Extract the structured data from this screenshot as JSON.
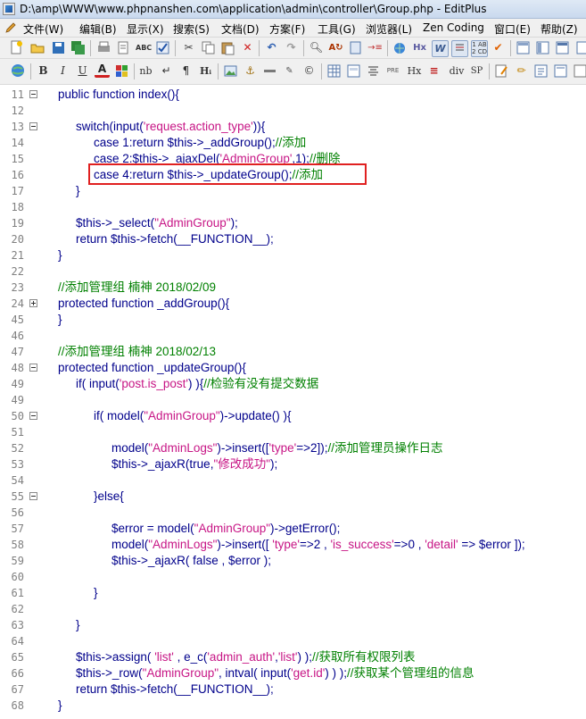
{
  "window": {
    "title": "D:\\amp\\WWW\\www.phpnanshen.com\\application\\admin\\controller\\Group.php - EditPlus"
  },
  "menu": [
    "文件(W)",
    "编辑(B)",
    "显示(X)",
    "搜索(S)",
    "文档(D)",
    "方案(F)",
    "工具(G)",
    "浏览器(L)",
    "Zen Coding",
    "窗口(E)",
    "帮助(Z)"
  ],
  "toolbar1": {
    "icons": [
      "new-file",
      "open-folder",
      "save",
      "save-all",
      "print",
      "print-preview",
      "spell-check",
      "check",
      "cut",
      "copy",
      "paste",
      "delete",
      "undo",
      "redo",
      "find",
      "replace",
      "clipboard",
      "indent",
      "web-browser",
      "hex",
      "word-wrap",
      "line-numbers",
      "column-number",
      "check-mark",
      "function-list",
      "directory",
      "window-list",
      "tag-list"
    ]
  },
  "toolbar2": {
    "labels": {
      "nbsp": "nb",
      "pre": "PRE",
      "div": "div",
      "span": "SP",
      "hx": "Hx",
      "html": "Hᵢ"
    }
  },
  "code_lines": [
    {
      "n": "11",
      "fold": "minus",
      "segs": [
        {
          "t": "public function index(){",
          "c": ""
        }
      ]
    },
    {
      "n": "12",
      "segs": []
    },
    {
      "n": "13",
      "fold": "minus",
      "segs": [
        {
          "t": "    switch(input(",
          "c": ""
        },
        {
          "t": "'request.action_type'",
          "c": "str"
        },
        {
          "t": ")){",
          "c": ""
        }
      ]
    },
    {
      "n": "14",
      "segs": [
        {
          "t": "        case 1:return ",
          "c": ""
        },
        {
          "t": "$this",
          "c": "dol"
        },
        {
          "t": "->_addGroup();",
          "c": ""
        },
        {
          "t": "//添加",
          "c": "com"
        }
      ]
    },
    {
      "n": "15",
      "segs": [
        {
          "t": "        case 2:",
          "c": ""
        },
        {
          "t": "$this",
          "c": "dol"
        },
        {
          "t": "->_ajaxDel(",
          "c": ""
        },
        {
          "t": "'AdminGroup'",
          "c": "str"
        },
        {
          "t": ",1);",
          "c": ""
        },
        {
          "t": "//删除",
          "c": "com"
        }
      ]
    },
    {
      "n": "16",
      "segs": [
        {
          "t": "        case 4:return ",
          "c": ""
        },
        {
          "t": "$this",
          "c": "dol"
        },
        {
          "t": "->_updateGroup();",
          "c": ""
        },
        {
          "t": "//添加",
          "c": "com"
        }
      ]
    },
    {
      "n": "17",
      "segs": [
        {
          "t": "    }",
          "c": ""
        }
      ]
    },
    {
      "n": "18",
      "segs": []
    },
    {
      "n": "19",
      "segs": [
        {
          "t": "    ",
          "c": ""
        },
        {
          "t": "$this",
          "c": "dol"
        },
        {
          "t": "->_select(",
          "c": ""
        },
        {
          "t": "\"AdminGroup\"",
          "c": "str"
        },
        {
          "t": ");",
          "c": ""
        }
      ]
    },
    {
      "n": "20",
      "segs": [
        {
          "t": "    return ",
          "c": ""
        },
        {
          "t": "$this",
          "c": "dol"
        },
        {
          "t": "->fetch(__FUNCTION__);",
          "c": ""
        }
      ]
    },
    {
      "n": "21",
      "segs": [
        {
          "t": "}",
          "c": ""
        }
      ]
    },
    {
      "n": "22",
      "segs": []
    },
    {
      "n": "23",
      "segs": [
        {
          "t": "//添加管理组 楠神 2018/02/09",
          "c": "com"
        }
      ]
    },
    {
      "n": "24",
      "fold": "plus",
      "segs": [
        {
          "t": "protected function _addGroup(){",
          "c": ""
        }
      ]
    },
    {
      "n": "45",
      "segs": [
        {
          "t": "}",
          "c": ""
        }
      ]
    },
    {
      "n": "46",
      "segs": []
    },
    {
      "n": "47",
      "segs": [
        {
          "t": "//添加管理组 楠神 2018/02/13",
          "c": "com"
        }
      ]
    },
    {
      "n": "48",
      "fold": "minus",
      "segs": [
        {
          "t": "protected function _updateGroup(){",
          "c": ""
        }
      ]
    },
    {
      "n": "49",
      "segs": [
        {
          "t": "    if( input(",
          "c": ""
        },
        {
          "t": "'post.is_post'",
          "c": "str"
        },
        {
          "t": ") ){",
          "c": ""
        },
        {
          "t": "//检验有没有提交数据",
          "c": "com"
        }
      ]
    },
    {
      "n": "49b",
      "segs": []
    },
    {
      "n": "50",
      "fold": "minus",
      "segs": [
        {
          "t": "        if( model(",
          "c": ""
        },
        {
          "t": "\"AdminGroup\"",
          "c": "str"
        },
        {
          "t": ")->update() ){",
          "c": ""
        }
      ]
    },
    {
      "n": "51",
      "segs": []
    },
    {
      "n": "52",
      "segs": [
        {
          "t": "            model(",
          "c": ""
        },
        {
          "t": "\"AdminLogs\"",
          "c": "str"
        },
        {
          "t": ")->insert([",
          "c": ""
        },
        {
          "t": "'type'",
          "c": "str"
        },
        {
          "t": "=>2]);",
          "c": ""
        },
        {
          "t": "//添加管理员操作日志",
          "c": "com"
        }
      ]
    },
    {
      "n": "53",
      "segs": [
        {
          "t": "            ",
          "c": ""
        },
        {
          "t": "$this",
          "c": "dol"
        },
        {
          "t": "->_ajaxR(true,",
          "c": ""
        },
        {
          "t": "\"修改成功\"",
          "c": "str"
        },
        {
          "t": ");",
          "c": ""
        }
      ]
    },
    {
      "n": "54",
      "segs": []
    },
    {
      "n": "55",
      "fold": "minus",
      "segs": [
        {
          "t": "        }else{",
          "c": ""
        }
      ]
    },
    {
      "n": "56",
      "segs": []
    },
    {
      "n": "57",
      "segs": [
        {
          "t": "            ",
          "c": ""
        },
        {
          "t": "$error",
          "c": "dol"
        },
        {
          "t": " = model(",
          "c": ""
        },
        {
          "t": "\"AdminGroup\"",
          "c": "str"
        },
        {
          "t": ")->getError();",
          "c": ""
        }
      ]
    },
    {
      "n": "58",
      "segs": [
        {
          "t": "            model(",
          "c": ""
        },
        {
          "t": "\"AdminLogs\"",
          "c": "str"
        },
        {
          "t": ")->insert([ ",
          "c": ""
        },
        {
          "t": "'type'",
          "c": "str"
        },
        {
          "t": "=>2 , ",
          "c": ""
        },
        {
          "t": "'is_success'",
          "c": "str"
        },
        {
          "t": "=>0 , ",
          "c": ""
        },
        {
          "t": "'detail'",
          "c": "str"
        },
        {
          "t": " => ",
          "c": ""
        },
        {
          "t": "$error",
          "c": "dol"
        },
        {
          "t": " ]);",
          "c": ""
        }
      ]
    },
    {
      "n": "59",
      "segs": [
        {
          "t": "            ",
          "c": ""
        },
        {
          "t": "$this",
          "c": "dol"
        },
        {
          "t": "->_ajaxR( false , ",
          "c": ""
        },
        {
          "t": "$error",
          "c": "dol"
        },
        {
          "t": " );",
          "c": ""
        }
      ]
    },
    {
      "n": "60",
      "segs": []
    },
    {
      "n": "61",
      "segs": [
        {
          "t": "        }",
          "c": ""
        }
      ]
    },
    {
      "n": "62",
      "segs": []
    },
    {
      "n": "63",
      "segs": [
        {
          "t": "    }",
          "c": ""
        }
      ]
    },
    {
      "n": "64",
      "segs": []
    },
    {
      "n": "65",
      "segs": [
        {
          "t": "    ",
          "c": ""
        },
        {
          "t": "$this",
          "c": "dol"
        },
        {
          "t": "->assign( ",
          "c": ""
        },
        {
          "t": "'list'",
          "c": "str"
        },
        {
          "t": " , e_c(",
          "c": ""
        },
        {
          "t": "'admin_auth'",
          "c": "str"
        },
        {
          "t": ",",
          "c": ""
        },
        {
          "t": "'list'",
          "c": "str"
        },
        {
          "t": ") );",
          "c": ""
        },
        {
          "t": "//获取所有权限列表",
          "c": "com"
        }
      ]
    },
    {
      "n": "66",
      "segs": [
        {
          "t": "    ",
          "c": ""
        },
        {
          "t": "$this",
          "c": "dol"
        },
        {
          "t": "->_row(",
          "c": ""
        },
        {
          "t": "\"AdminGroup\"",
          "c": "str"
        },
        {
          "t": ", intval( input(",
          "c": ""
        },
        {
          "t": "'get.id'",
          "c": "str"
        },
        {
          "t": ") ) );",
          "c": ""
        },
        {
          "t": "//获取某个管理组的信息",
          "c": "com"
        }
      ]
    },
    {
      "n": "67",
      "segs": [
        {
          "t": "    return ",
          "c": ""
        },
        {
          "t": "$this",
          "c": "dol"
        },
        {
          "t": "->fetch(__FUNCTION__);",
          "c": ""
        }
      ]
    },
    {
      "n": "68",
      "segs": [
        {
          "t": "}",
          "c": ""
        }
      ]
    }
  ],
  "colors": {
    "keyword": "#00008b",
    "string": "#c71585",
    "comment": "#008000",
    "highlight_box": "#e02020"
  }
}
